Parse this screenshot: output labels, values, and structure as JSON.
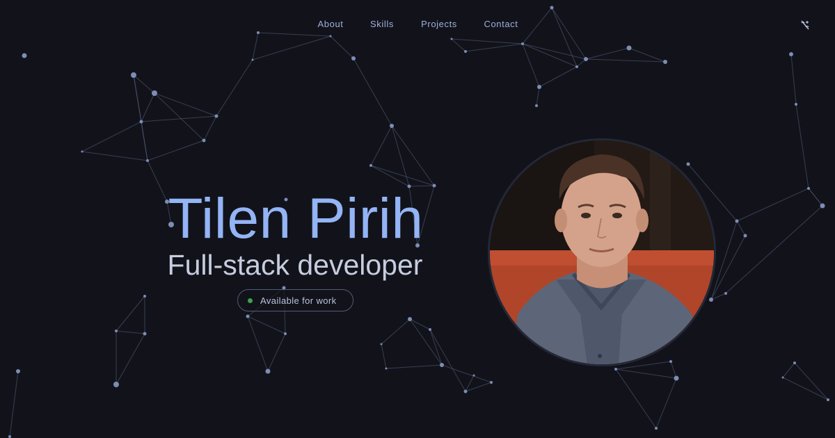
{
  "nav": {
    "links": [
      "About",
      "Skills",
      "Projects",
      "Contact"
    ]
  },
  "theme_toggle": {
    "icon": "theme-toggle-icon"
  },
  "hero": {
    "name": "Tilen Pirih",
    "role": "Full-stack developer",
    "status": "Available for work"
  },
  "colors": {
    "background": "#12131a",
    "accent": "#93b4f5",
    "nav_text": "#9fb0d8",
    "status_green": "#3fa24c",
    "network_node": "#7d8db5"
  }
}
